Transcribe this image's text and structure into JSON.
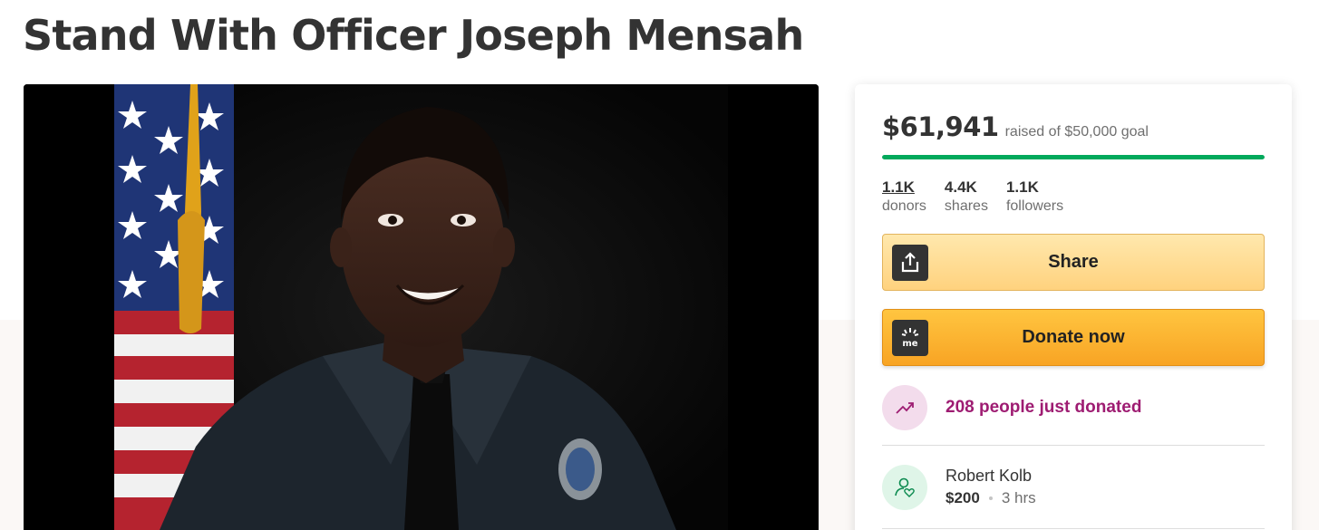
{
  "campaign": {
    "title": "Stand With Officer Joseph Mensah"
  },
  "hero": {
    "image_alt": "Portrait of a police officer in uniform in front of an American flag"
  },
  "donation_panel": {
    "raised_amount": "$61,941",
    "raised_text": "raised of $50,000 goal",
    "progress_fraction": 1.0,
    "stats": [
      {
        "value": "1.1K",
        "label": "donors",
        "link": true
      },
      {
        "value": "4.4K",
        "label": "shares",
        "link": false
      },
      {
        "value": "1.1K",
        "label": "followers",
        "link": false
      }
    ],
    "share_button": {
      "label": "Share",
      "icon": "share-upload-icon"
    },
    "donate_button": {
      "label": "Donate now",
      "icon": "gofundme-logo-icon"
    },
    "activity": {
      "text": "208 people just donated",
      "icon": "trending-up-icon"
    },
    "recent_donation": {
      "name": "Robert Kolb",
      "amount": "$200",
      "time": "3 hrs",
      "icon": "donor-heart-icon"
    }
  },
  "colors": {
    "progress_green": "#02a95c",
    "donate_orange": "#f8a424",
    "share_yellow": "#ffd27e",
    "activity_magenta": "#9e1c72"
  }
}
